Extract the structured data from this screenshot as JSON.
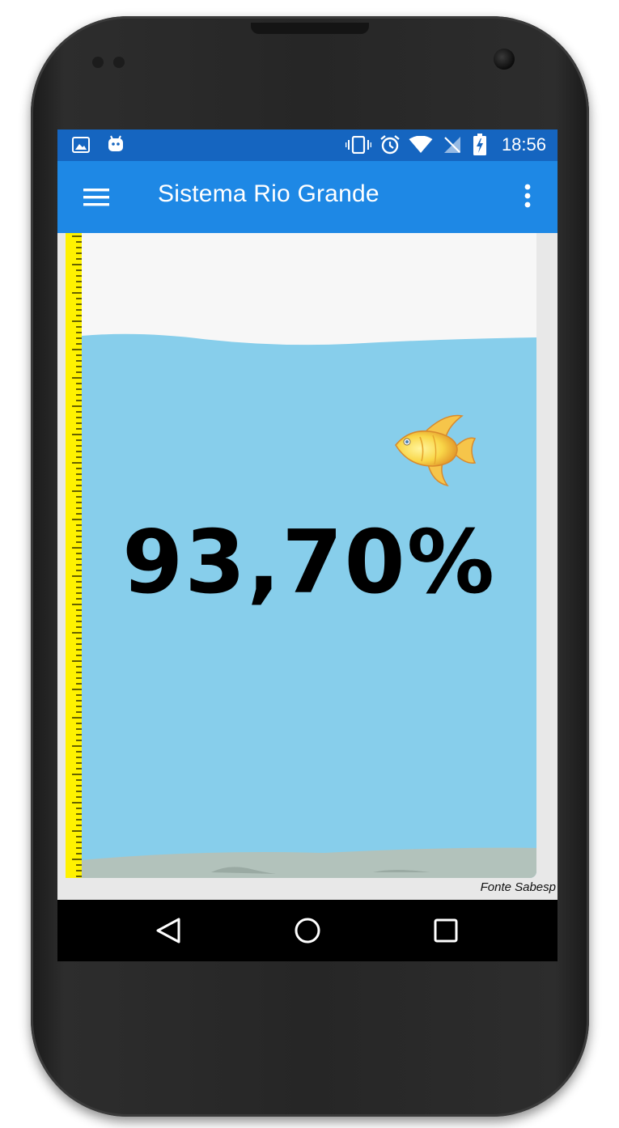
{
  "status_bar": {
    "time": "18:56",
    "left_icons": [
      "image-icon",
      "android-icon"
    ],
    "right_icons": [
      "vibrate-icon",
      "alarm-icon",
      "wifi-icon",
      "no-signal-icon",
      "battery-charging-icon"
    ]
  },
  "app_bar": {
    "title": "Sistema Rio Grande",
    "color": "#1e88e5",
    "status_color": "#1565c0"
  },
  "reservoir": {
    "level_text": "93,70%",
    "level_fraction": 0.937,
    "water_color": "#87ceeb",
    "ruler_color": "#fff200"
  },
  "footer": {
    "source": "Fonte Sabesp"
  },
  "navigation": [
    "back",
    "home",
    "recents"
  ]
}
